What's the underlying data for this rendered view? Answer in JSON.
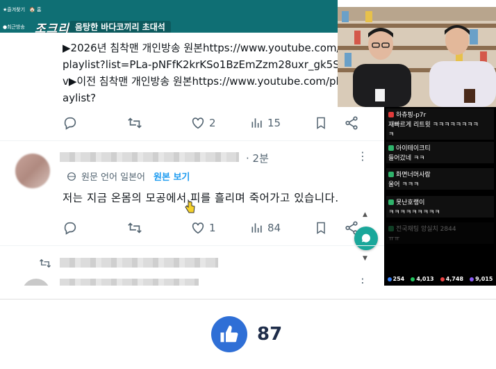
{
  "stream": {
    "top_links": [
      "★즐겨찾기",
      "🏠 홈"
    ],
    "recent_label": "●최근방송",
    "logo_text": "조크리",
    "title": "음탕한 바다코끼리 초대석"
  },
  "tweet": {
    "body": "▶2026년 침착맨 개인방송 원본https://www.youtube.com/playlist?list=PLa-pNFfK2krKSo1BzEmZzm28uxr_gk5Sv▶이전 침착맨 개인방송 원본https://www.youtube.com/playlist?",
    "likes": "2",
    "views": "15"
  },
  "reply": {
    "time": "· 2분",
    "translate_label": "원문 언어 일본어",
    "translate_link": "원본 보기",
    "text": "저는 지금 온몸의 모공에서 피를 흘리며 죽어가고 있습니다.",
    "likes": "1",
    "views": "84"
  },
  "chat": {
    "messages": [
      {
        "name": "하츄핑-p7r",
        "text": "재빠르게 리트윗 ㅋㅋㅋㅋㅋㅋㅋㅋ",
        "text2": "ㅋ",
        "badge_color": "#e03a3a"
      },
      {
        "name": "아이테이크티",
        "text": "들어갔네 ㅋㅋ",
        "badge_color": "#2fb36b"
      },
      {
        "name": "화면너머사람",
        "text": "울어 ㅋㅋㅋ",
        "badge_color": "#2fb36b"
      },
      {
        "name": "못난호랭이",
        "text": "ㅋㅋㅋㅋㅋㅋㅋㅋㅋ",
        "badge_color": "#2fb36b"
      },
      {
        "name": "전국채팅 앙실치 2844",
        "text": "ㅠㅠ",
        "badge_color": "#2fb36b"
      }
    ],
    "stats": [
      {
        "value": "254",
        "color": "#3b82f6"
      },
      {
        "value": "4,013",
        "color": "#22c55e"
      },
      {
        "value": "4,748",
        "color": "#ef4444"
      },
      {
        "value": "9,015",
        "color": "#8b5cf6"
      }
    ]
  },
  "like": {
    "count": "87",
    "color": "#2f6fd6"
  }
}
